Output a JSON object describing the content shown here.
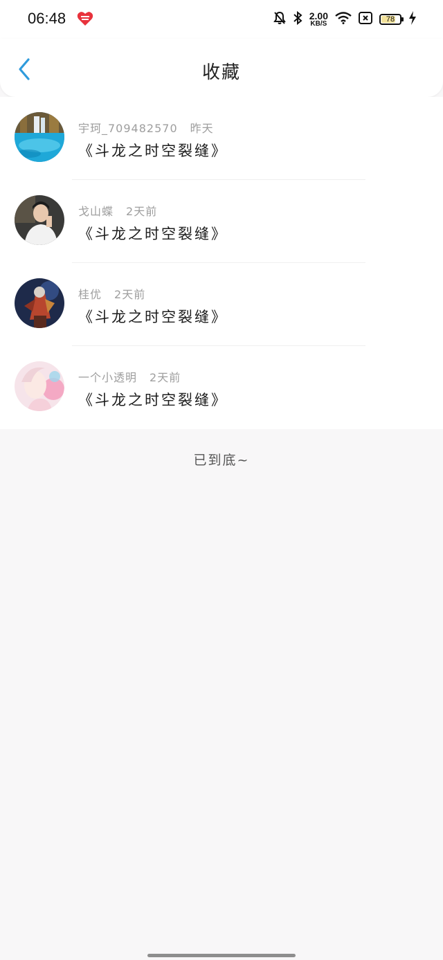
{
  "status_bar": {
    "time": "06:48",
    "net_speed_value": "2.00",
    "net_speed_unit": "KB/S",
    "battery_level": "78",
    "battery_fill_fraction": 0.78,
    "battery_color": "#f3e29b"
  },
  "header": {
    "title": "收藏",
    "back_icon": "chevron-left-icon",
    "back_color": "#2f9bdc"
  },
  "favorites": [
    {
      "author": "宇珂_709482570",
      "time": "昨天",
      "title": "《斗龙之时空裂缝》"
    },
    {
      "author": "戈山蝶",
      "time": "2天前",
      "title": "《斗龙之时空裂缝》"
    },
    {
      "author": "桂优",
      "time": "2天前",
      "title": "《斗龙之时空裂缝》"
    },
    {
      "author": "一个小透明",
      "time": "2天前",
      "title": "《斗龙之时空裂缝》"
    }
  ],
  "footer": {
    "end_text": "已到底~"
  }
}
